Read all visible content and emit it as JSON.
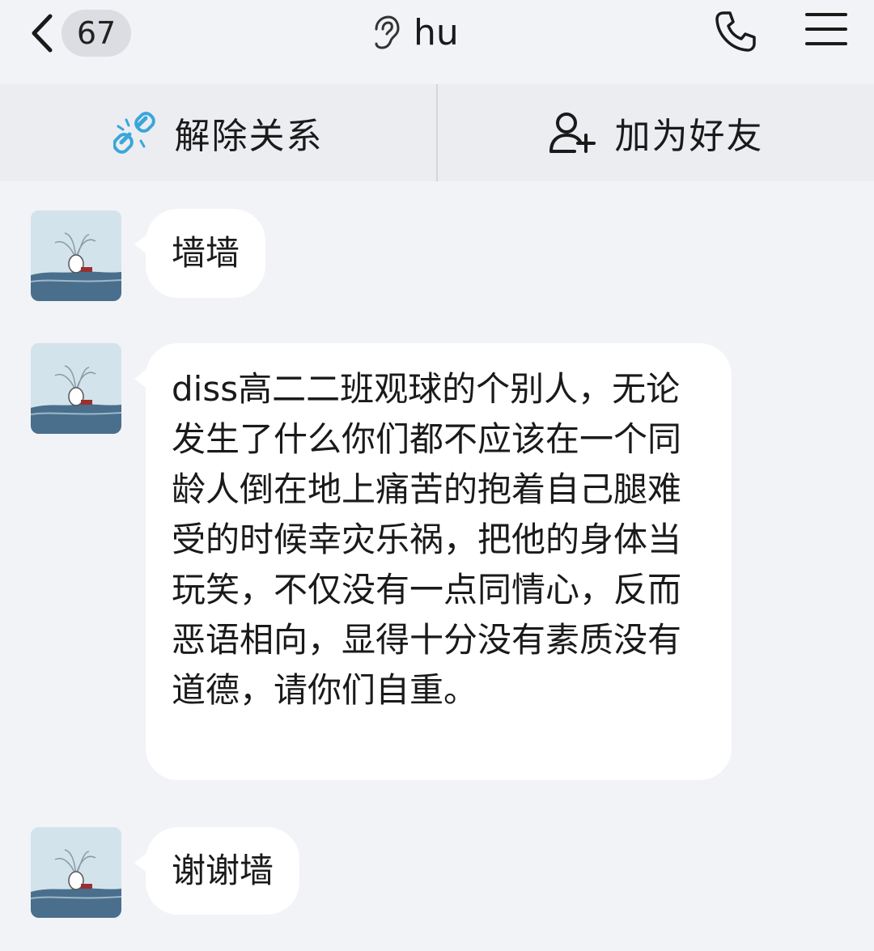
{
  "header": {
    "back_badge": "67",
    "title": "hu"
  },
  "actions": [
    {
      "label": "解除关系",
      "icon": "unlink-icon"
    },
    {
      "label": "加为好友",
      "icon": "add-friend-icon"
    }
  ],
  "messages": [
    {
      "text": "墙墙"
    },
    {
      "text": "diss高二二班观球的个别人，无论发生了什么你们都不应该在一个同龄人倒在地上痛苦的抱着自己腿难受的时候幸灾乐祸，把他的身体当玩笑，不仅没有一点同情心，反而恶语相向，显得十分没有素质没有道德，请你们自重。"
    },
    {
      "text": "谢谢墙"
    }
  ],
  "colors": {
    "background": "#f2f3f7",
    "bubble": "#ffffff",
    "accent": "#3aa6d9"
  }
}
